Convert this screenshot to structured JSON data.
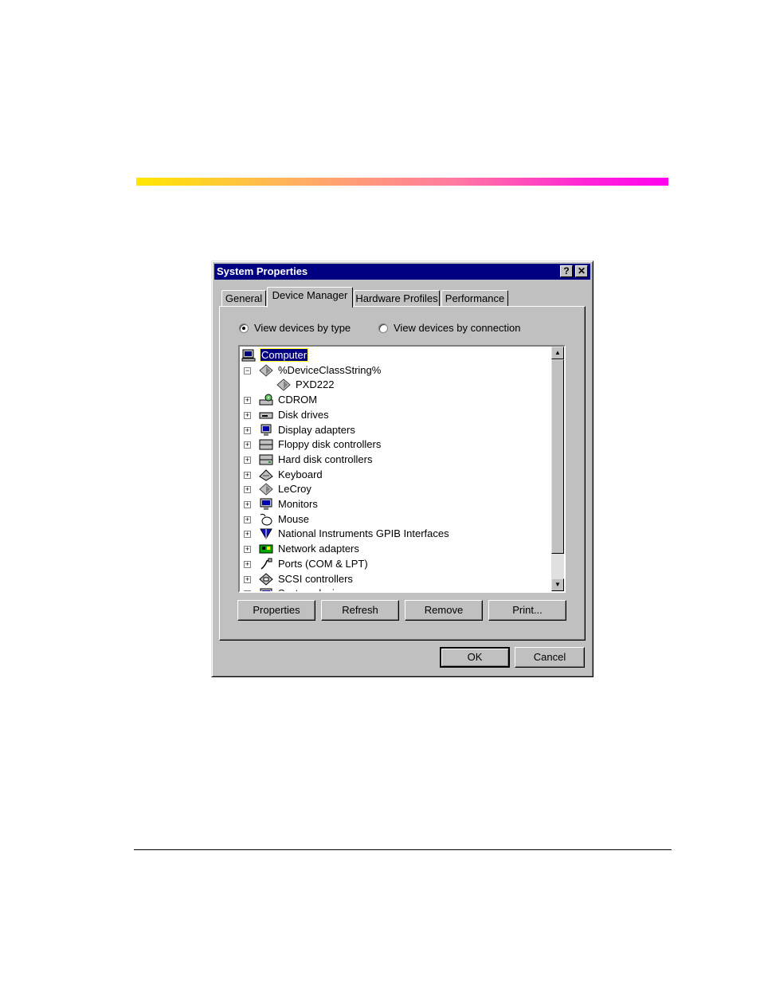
{
  "decoration": {
    "gradient_colors": [
      "#ffe800",
      "#ff00ee"
    ]
  },
  "dialog": {
    "title": "System Properties",
    "help_button": "?",
    "close_button": "✕",
    "tabs": [
      {
        "label": "General",
        "active": false
      },
      {
        "label": "Device Manager",
        "active": true
      },
      {
        "label": "Hardware Profiles",
        "active": false
      },
      {
        "label": "Performance",
        "active": false
      }
    ],
    "view_options": [
      {
        "label": "View devices by type",
        "selected": true
      },
      {
        "label": "View devices by connection",
        "selected": false
      }
    ],
    "device_tree": [
      {
        "label": "Computer",
        "icon": "computer-icon",
        "selected": true,
        "expander": ""
      },
      {
        "label": "%DeviceClassString%",
        "icon": "diamond-device-icon",
        "expander": "−"
      },
      {
        "label": "PXD222",
        "icon": "diamond-device-icon",
        "expander": ""
      },
      {
        "label": "CDROM",
        "icon": "cdrom-icon",
        "expander": "+"
      },
      {
        "label": "Disk drives",
        "icon": "disk-drive-icon",
        "expander": "+"
      },
      {
        "label": "Display adapters",
        "icon": "display-adapter-icon",
        "expander": "+"
      },
      {
        "label": "Floppy disk controllers",
        "icon": "floppy-controller-icon",
        "expander": "+"
      },
      {
        "label": "Hard disk controllers",
        "icon": "hard-disk-controller-icon",
        "expander": "+"
      },
      {
        "label": "Keyboard",
        "icon": "keyboard-icon",
        "expander": "+"
      },
      {
        "label": "LeCroy",
        "icon": "diamond-device-icon",
        "expander": "+"
      },
      {
        "label": "Monitors",
        "icon": "monitor-icon",
        "expander": "+"
      },
      {
        "label": "Mouse",
        "icon": "mouse-icon",
        "expander": "+"
      },
      {
        "label": "National Instruments GPIB Interfaces",
        "icon": "gpib-icon",
        "expander": "+"
      },
      {
        "label": "Network adapters",
        "icon": "network-adapter-icon",
        "expander": "+"
      },
      {
        "label": "Ports (COM & LPT)",
        "icon": "ports-icon",
        "expander": "+"
      },
      {
        "label": "SCSI controllers",
        "icon": "scsi-icon",
        "expander": "+"
      },
      {
        "label": "System devices",
        "icon": "system-devices-icon",
        "expander": "+"
      }
    ],
    "buttons": {
      "properties": "Properties",
      "refresh": "Refresh",
      "remove": "Remove",
      "print": "Print...",
      "ok": "OK",
      "cancel": "Cancel"
    }
  }
}
